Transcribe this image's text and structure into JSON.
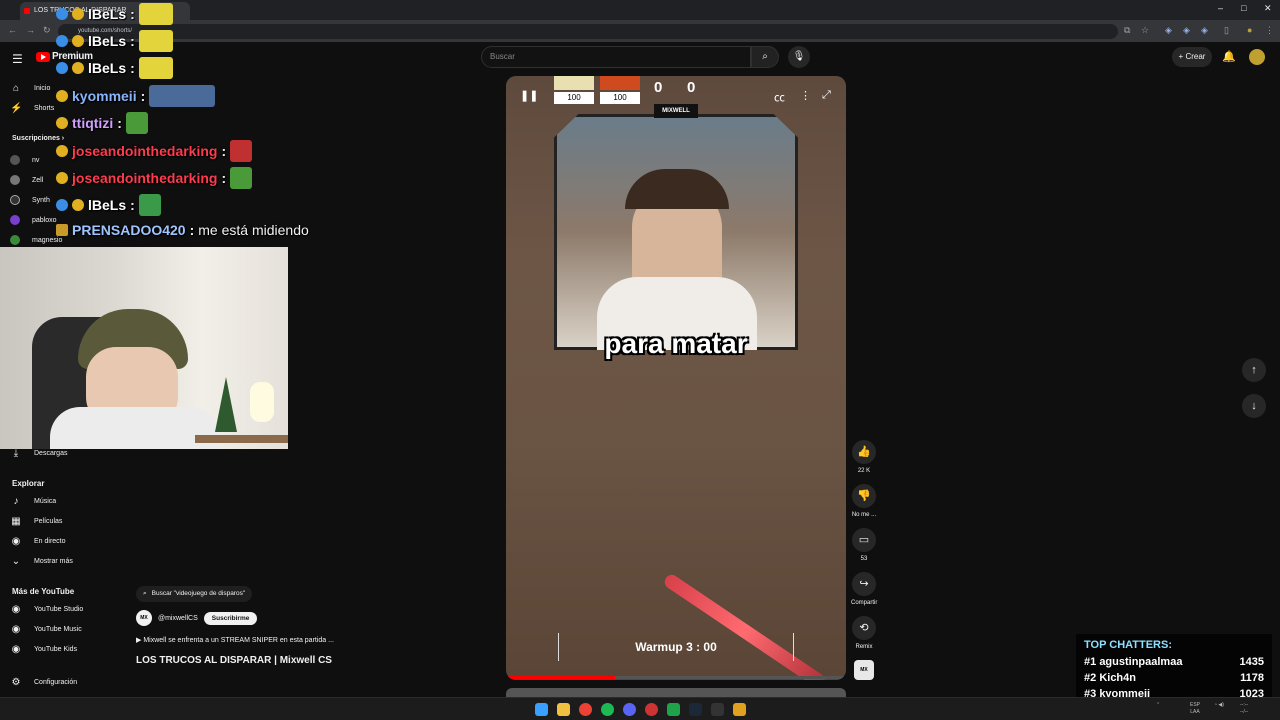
{
  "browser": {
    "tab_title": "LOS TRUCOS AL DISPARAR",
    "url": "youtube.com/shorts/",
    "window_controls": [
      "–",
      "□",
      "✕"
    ]
  },
  "youtube": {
    "logo_text": "Premium",
    "search_placeholder": "Buscar",
    "create_label": "Crear"
  },
  "sidebar": {
    "top_items": [
      {
        "label": "Inicio",
        "icon": "home-icon"
      },
      {
        "label": "Shorts",
        "icon": "shorts-icon"
      }
    ],
    "subscriptions_header": "Suscripciones",
    "subscriptions": [
      "nv",
      "Zell",
      "Synth",
      "pabloxo",
      "magnesio"
    ],
    "downloads_label": "Descargas",
    "explore_header": "Explorar",
    "explore_items": [
      {
        "label": "Música",
        "icon": "music-icon"
      },
      {
        "label": "Películas",
        "icon": "film-icon"
      },
      {
        "label": "En directo",
        "icon": "live-icon"
      },
      {
        "label": "Mostrar más",
        "icon": "chevron-down-icon"
      }
    ],
    "more_header": "Más de YouTube",
    "more_items": [
      "YouTube Studio",
      "YouTube Music",
      "YouTube Kids"
    ],
    "settings_label": "Configuración"
  },
  "chat": [
    {
      "user": "lBeLs",
      "text": "",
      "color": "#ffffff"
    },
    {
      "user": "lBeLs",
      "text": "",
      "color": "#ffffff"
    },
    {
      "user": "lBeLs",
      "text": "",
      "color": "#ffffff"
    },
    {
      "user": "kyommeii",
      "text": "",
      "color": "#8ab4f8"
    },
    {
      "user": "ttiqtizi",
      "text": "",
      "color": "#d0a0ff"
    },
    {
      "user": "joseandointhedarking",
      "text": "",
      "color": "#ff3b4e"
    },
    {
      "user": "joseandointhedarking",
      "text": "",
      "color": "#ff3b4e"
    },
    {
      "user": "lBeLs",
      "text": "",
      "color": "#ffffff"
    },
    {
      "user": "PRENSADOO420",
      "text": "me está midiendo",
      "color": "#a0c4ff"
    }
  ],
  "player": {
    "score_left": "0",
    "score_right": "0",
    "hp_left": "100",
    "hp_right": "100",
    "team_logo": "MIXWELL",
    "caption": "para matar",
    "warmup_text": "Warmup 3 : 00",
    "progress": 0.32
  },
  "actions": {
    "likes": "22 K",
    "dislike_label": "No me ...",
    "comments": "53",
    "share_label": "Compartir",
    "remix_label": "Remix"
  },
  "meta": {
    "search_chip": "Buscar \"videojuego de disparos\"",
    "channel": "@mixwellCS",
    "subscribe_label": "Suscribirme",
    "description": "Mixwell se enfrenta a un STREAM SNIPER en esta partida ...",
    "title": "LOS TRUCOS AL DISPARAR | Mixwell CS"
  },
  "top_chatters": {
    "header": "TOP CHATTERS:",
    "rows": [
      {
        "rank": "#1",
        "name": "agustinpaalmaa",
        "count": "1435"
      },
      {
        "rank": "#2",
        "name": "Kich4n",
        "count": "1178"
      },
      {
        "rank": "#3",
        "name": "kyommeii",
        "count": "1023"
      }
    ]
  },
  "colors": {
    "accent_red": "#ff0000",
    "chatters_header": "#8ee0ff"
  }
}
